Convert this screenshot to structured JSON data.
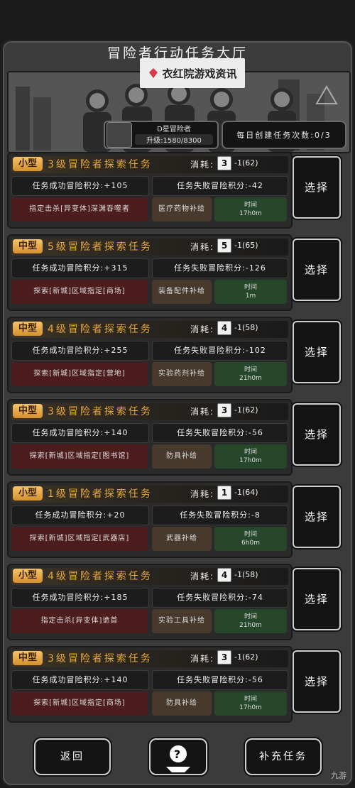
{
  "title": "冒险者行动任务大厅",
  "watermark": "衣红院游戏资讯",
  "rank": {
    "title": "D星冒险者",
    "upgrade": "升级:1580/8300"
  },
  "daily": "每日创建任务次数:0/3",
  "cost_label": "消耗:",
  "reward_time_label": "时间",
  "select_label": "选择",
  "tasks": [
    {
      "size": "小型",
      "name": "3级冒险者探索任务",
      "dice": "3",
      "cost": "-1(62)",
      "success": "任务成功冒险积分:+105",
      "fail": "任务失败冒险积分:-42",
      "objective": "指定击杀[异变体]深渊吞噬者",
      "reward": "医疗药物补给",
      "time": "17h0m"
    },
    {
      "size": "中型",
      "name": "5级冒险者探索任务",
      "dice": "5",
      "cost": "-1(65)",
      "success": "任务成功冒险积分:+315",
      "fail": "任务失败冒险积分:-126",
      "objective": "探索[新城]区域指定[商场]",
      "reward": "装备配件补给",
      "time": "1m"
    },
    {
      "size": "中型",
      "name": "4级冒险者探索任务",
      "dice": "4",
      "cost": "-1(58)",
      "success": "任务成功冒险积分:+255",
      "fail": "任务失败冒险积分:-102",
      "objective": "探索[新城]区域指定[营地]",
      "reward": "实验药剂补给",
      "time": "21h0m"
    },
    {
      "size": "中型",
      "name": "3级冒险者探索任务",
      "dice": "3",
      "cost": "-1(62)",
      "success": "任务成功冒险积分:+140",
      "fail": "任务失败冒险积分:-56",
      "objective": "探索[新城]区域指定[图书馆]",
      "reward": "防具补给",
      "time": "17h0m"
    },
    {
      "size": "小型",
      "name": "1级冒险者探索任务",
      "dice": "1",
      "cost": "-1(64)",
      "success": "任务成功冒险积分:+20",
      "fail": "任务失败冒险积分:-8",
      "objective": "探索[新城]区域指定[武器店]",
      "reward": "武器补给",
      "time": "6h0m"
    },
    {
      "size": "小型",
      "name": "4级冒险者探索任务",
      "dice": "4",
      "cost": "-1(58)",
      "success": "任务成功冒险积分:+185",
      "fail": "任务失败冒险积分:-74",
      "objective": "指定击杀[异变体]诡首",
      "reward": "实验工具补给",
      "time": "21h0m"
    },
    {
      "size": "中型",
      "name": "3级冒险者探索任务",
      "dice": "3",
      "cost": "-1(62)",
      "success": "任务成功冒险积分:+140",
      "fail": "任务失败冒险积分:-56",
      "objective": "探索[新城]区域指定[商场]",
      "reward": "防具补给",
      "time": "17h0m"
    }
  ],
  "buttons": {
    "back": "返回",
    "replenish": "补充任务"
  },
  "footer_logo": "九游"
}
